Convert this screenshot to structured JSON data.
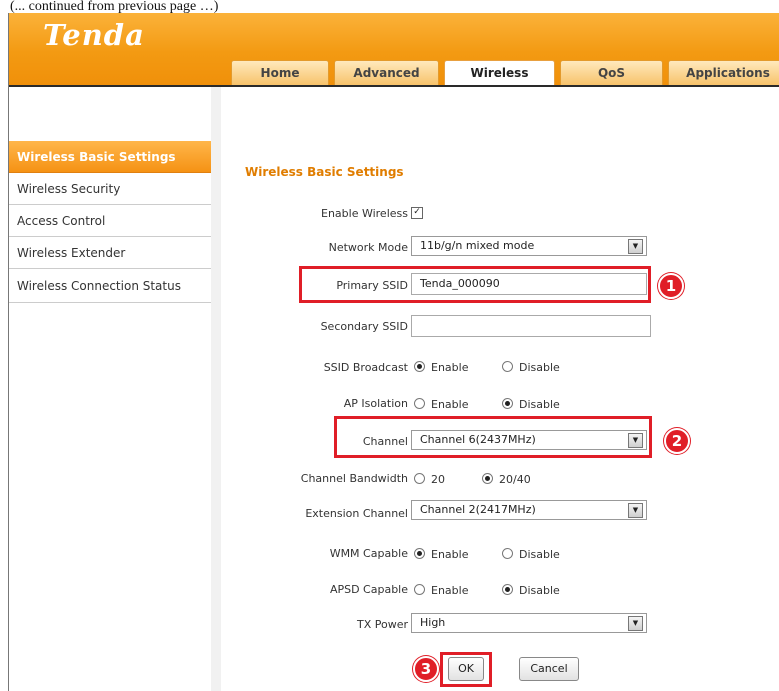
{
  "page_top_text": "(... continued from previous page …)",
  "brand": {
    "logo": "Tenda"
  },
  "tabs": [
    {
      "label": "Home",
      "active": false
    },
    {
      "label": "Advanced",
      "active": false
    },
    {
      "label": "Wireless",
      "active": true
    },
    {
      "label": "QoS",
      "active": false
    },
    {
      "label": "Applications",
      "active": false
    }
  ],
  "sidebar": {
    "items": [
      {
        "label": "Wireless Basic Settings",
        "active": true
      },
      {
        "label": "Wireless Security"
      },
      {
        "label": "Access Control"
      },
      {
        "label": "Wireless Extender"
      },
      {
        "label": "Wireless Connection Status"
      }
    ]
  },
  "form": {
    "title": "Wireless Basic Settings",
    "enable_wireless": {
      "label": "Enable Wireless",
      "checked": true,
      "check_glyph": "✓"
    },
    "network_mode": {
      "label": "Network Mode",
      "value": "11b/g/n mixed mode"
    },
    "primary_ssid": {
      "label": "Primary SSID",
      "value": "Tenda_000090"
    },
    "secondary_ssid": {
      "label": "Secondary SSID",
      "value": ""
    },
    "ssid_broadcast": {
      "label": "SSID Broadcast",
      "option1": "Enable",
      "option2": "Disable",
      "selected": "Enable"
    },
    "ap_isolation": {
      "label": "AP Isolation",
      "option1": "Enable",
      "option2": "Disable",
      "selected": "Disable"
    },
    "channel": {
      "label": "Channel",
      "value": "Channel 6(2437MHz)"
    },
    "channel_bandwidth": {
      "label": "Channel Bandwidth",
      "option1": "20",
      "option2": "20/40",
      "selected": "20/40"
    },
    "extension_channel": {
      "label": "Extension Channel",
      "value": "Channel 2(2417MHz)"
    },
    "wmm_capable": {
      "label": "WMM Capable",
      "option1": "Enable",
      "option2": "Disable",
      "selected": "Enable"
    },
    "apsd_capable": {
      "label": "APSD Capable",
      "option1": "Enable",
      "option2": "Disable",
      "selected": "Disable"
    },
    "tx_power": {
      "label": "TX Power",
      "value": "High"
    },
    "ok_label": "OK",
    "cancel_label": "Cancel"
  },
  "annotations": {
    "step1": "1",
    "step2": "2",
    "step3": "3",
    "color": "#e01e27"
  },
  "icons": {
    "dropdown_arrow": "▼"
  },
  "colors": {
    "accent": "#f39a12",
    "title": "#e07d00"
  }
}
